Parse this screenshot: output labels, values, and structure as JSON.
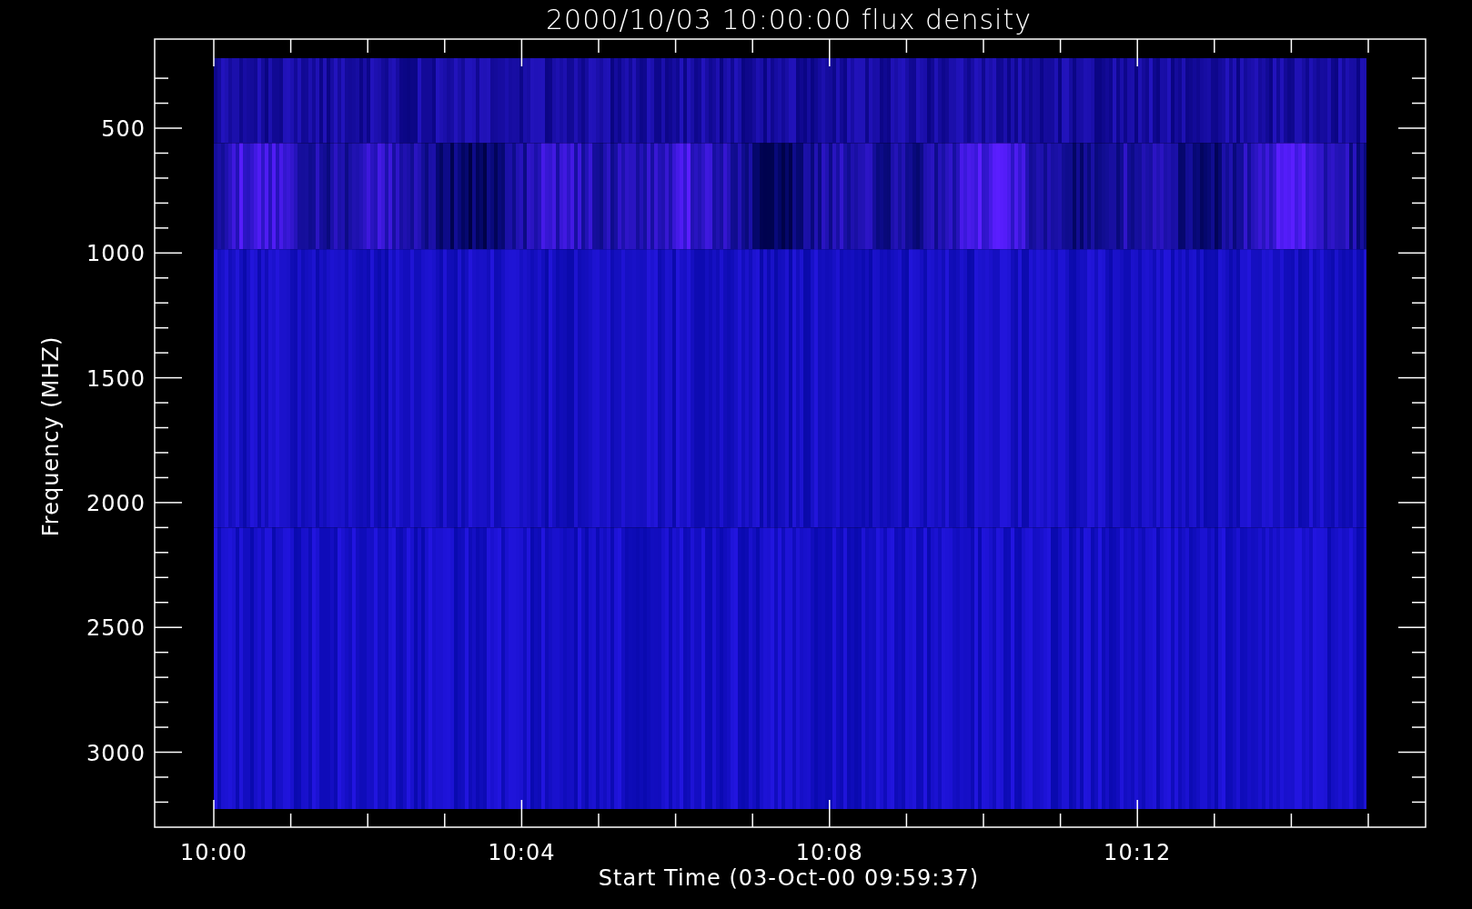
{
  "title": "2000/10/03 10:00:00 flux density",
  "y_axis": {
    "label": "Frequency (MHZ)",
    "ticks": [
      "500",
      "1000",
      "1500",
      "2000",
      "2500",
      "3000"
    ]
  },
  "x_axis": {
    "label": "Start Time (03-Oct-00 09:59:37)",
    "ticks": [
      "10:00",
      "10:04",
      "10:08",
      "10:12"
    ]
  }
}
